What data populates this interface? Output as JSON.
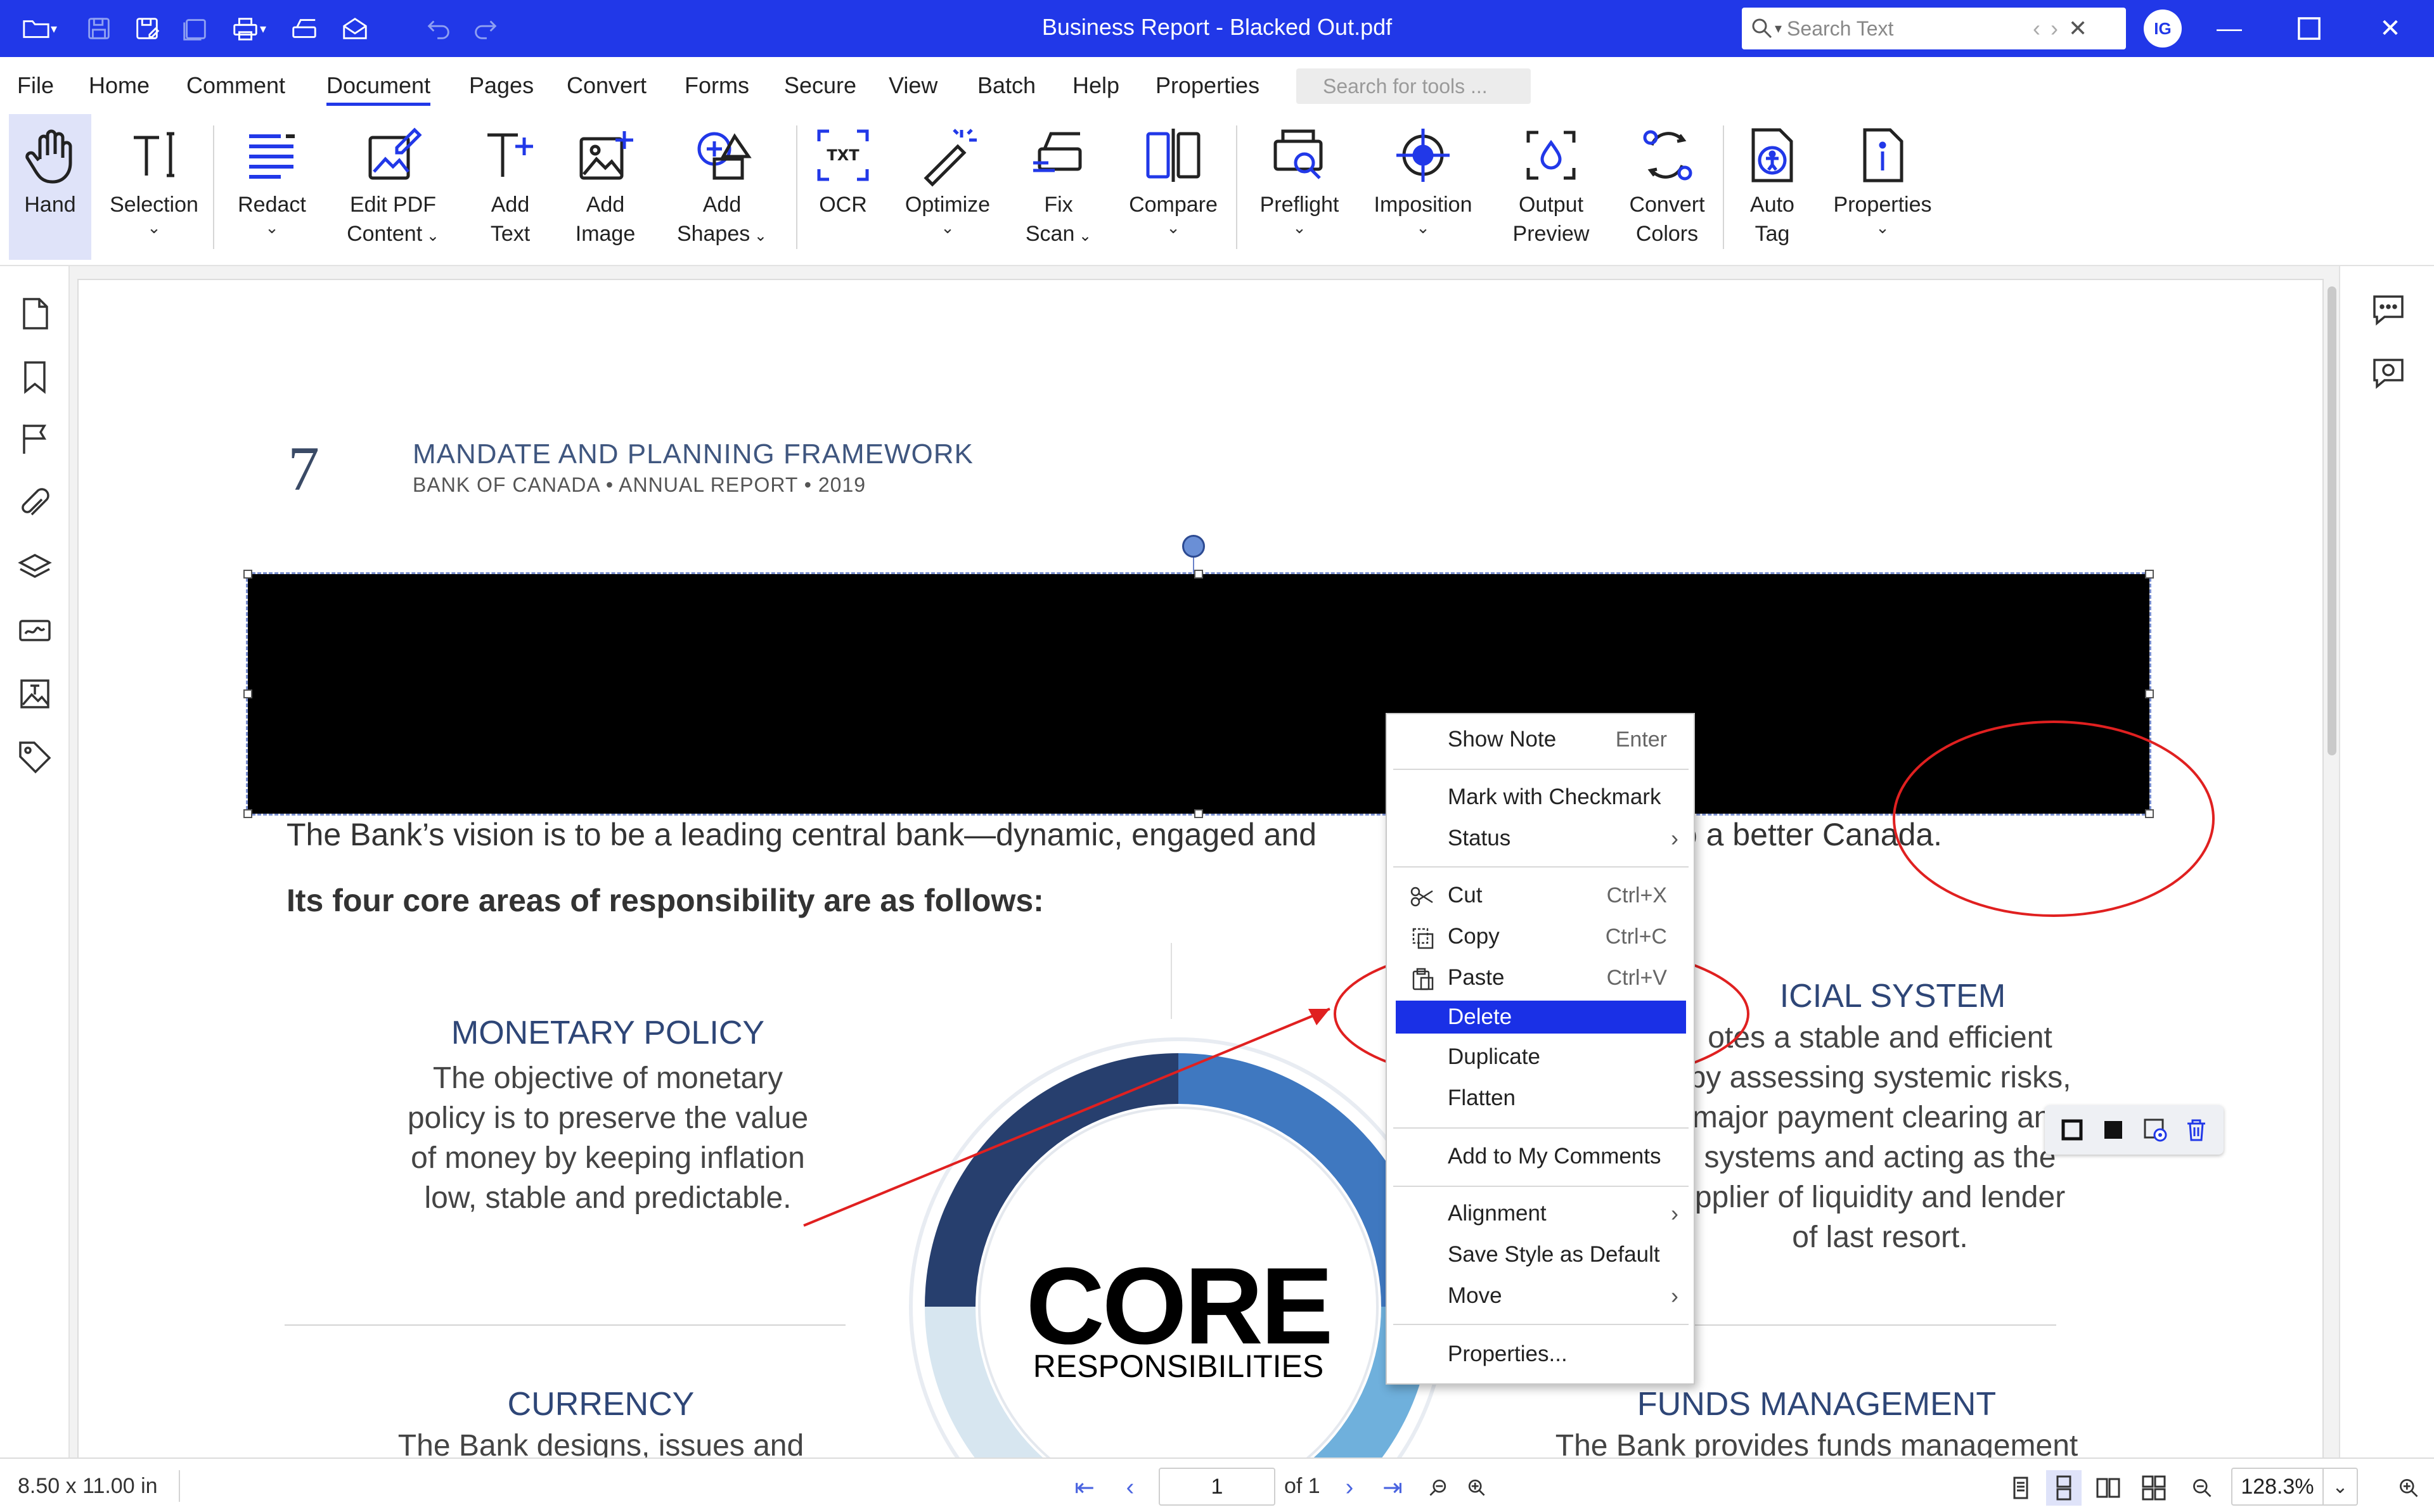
{
  "titlebar": {
    "title": "Business Report - Blacked Out.pdf",
    "search_placeholder": "Search Text",
    "user_initials": "IG"
  },
  "menu": {
    "items": [
      "File",
      "Home",
      "Comment",
      "Document",
      "Pages",
      "Convert",
      "Forms",
      "Secure",
      "View",
      "Batch",
      "Help",
      "Properties"
    ],
    "active": "Document",
    "tools_search_placeholder": "Search for tools ..."
  },
  "ribbon": {
    "hand": "Hand",
    "selection": "Selection",
    "redact": "Redact",
    "edit_pdf_l1": "Edit PDF",
    "edit_pdf_l2": "Content",
    "add_text_l1": "Add",
    "add_text_l2": "Text",
    "add_image_l1": "Add",
    "add_image_l2": "Image",
    "add_shapes_l1": "Add",
    "add_shapes_l2": "Shapes",
    "ocr": "OCR",
    "optimize": "Optimize",
    "fix_scan_l1": "Fix",
    "fix_scan_l2": "Scan",
    "compare": "Compare",
    "preflight": "Preflight",
    "imposition": "Imposition",
    "output_preview_l1": "Output",
    "output_preview_l2": "Preview",
    "convert_colors_l1": "Convert",
    "convert_colors_l2": "Colors",
    "auto_tag_l1": "Auto",
    "auto_tag_l2": "Tag",
    "properties": "Properties"
  },
  "document": {
    "page_number": "7",
    "title": "MANDATE AND PLANNING FRAMEWORK",
    "subtitle": "BANK OF CANADA  •  ANNUAL REPORT  •  2019",
    "vision_text": "The Bank’s vision is to be a leading central bank—dynamic, engaged and",
    "vision_text_end": "to a better Canada.",
    "areas_heading": "Its four core areas of responsibility are as follows:",
    "monetary_head": "MONETARY POLICY",
    "monetary_body": [
      "The objective of monetary",
      "policy is to preserve the value",
      "of money by keeping inflation",
      "low, stable and predictable."
    ],
    "financial_head": "FINANCIAL SYSTEM",
    "financial_head_visible": "ICIAL SYSTEM",
    "financial_body": [
      "otes a stable and efficient",
      "by assessing systemic risks,",
      "major payment clearing and",
      "systems and acting as the",
      "pplier of liquidity and lender",
      "of  last resort."
    ],
    "currency_head": "CURRENCY",
    "currency_body": "The Bank designs, issues and",
    "funds_head": "FUNDS MANAGEMENT",
    "funds_body": "The Bank provides funds management",
    "core_word": "CORE",
    "core_sub": "RESPONSIBILITIES"
  },
  "context_menu": {
    "show_note": "Show Note",
    "show_note_sc": "Enter",
    "mark_checkmark": "Mark with Checkmark",
    "status": "Status",
    "cut": "Cut",
    "cut_sc": "Ctrl+X",
    "copy": "Copy",
    "copy_sc": "Ctrl+C",
    "paste": "Paste",
    "paste_sc": "Ctrl+V",
    "delete": "Delete",
    "duplicate": "Duplicate",
    "flatten": "Flatten",
    "add_comments": "Add to My Comments",
    "alignment": "Alignment",
    "save_style": "Save Style as Default",
    "move": "Move",
    "properties": "Properties..."
  },
  "statusbar": {
    "page_size": "8.50 x 11.00 in",
    "current_page": "1",
    "page_of": "of 1",
    "zoom": "128.3%"
  },
  "colors": {
    "accent": "#2138e8",
    "menu_selection": "#1a30e6",
    "annotation_red": "#e02020",
    "heading_navy": "#2e4677"
  }
}
